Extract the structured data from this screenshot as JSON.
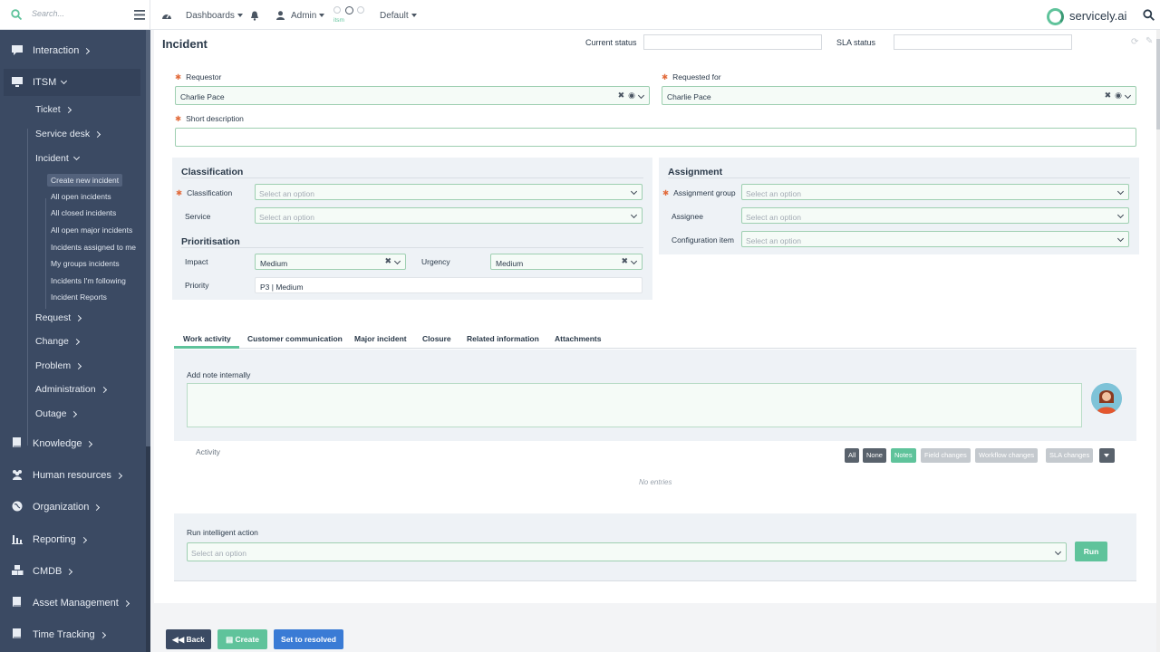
{
  "topbar": {
    "search_placeholder": "Search...",
    "dashboards": "Dashboards",
    "admin": "Admin",
    "itsm_label": "itsm",
    "default": "Default",
    "brand": "servicely.ai"
  },
  "sidebar": {
    "top_items": [
      "Interaction",
      "ITSM",
      "Knowledge",
      "Human resources",
      "Organization",
      "Reporting",
      "CMDB",
      "Asset Management",
      "Time Tracking"
    ],
    "itsm_sub": [
      "Ticket",
      "Service desk",
      "Incident",
      "Request",
      "Change",
      "Problem",
      "Administration",
      "Outage"
    ],
    "incident_sub": [
      "Create new incident",
      "All open incidents",
      "All closed incidents",
      "All open major incidents",
      "Incidents assigned to me",
      "My groups incidents",
      "Incidents I'm following",
      "Incident Reports"
    ]
  },
  "header": {
    "title": "Incident",
    "current_status_label": "Current status",
    "sla_status_label": "SLA status"
  },
  "form": {
    "requestor_label": "Requestor",
    "requestor_value": "Charlie Pace",
    "requested_for_label": "Requested for",
    "requested_for_value": "Charlie Pace",
    "short_description_label": "Short description",
    "placeholder": "Select an option"
  },
  "classification": {
    "title": "Classification",
    "classification_label": "Classification",
    "service_label": "Service"
  },
  "prioritisation": {
    "title": "Prioritisation",
    "impact_label": "Impact",
    "impact_value": "Medium",
    "urgency_label": "Urgency",
    "urgency_value": "Medium",
    "priority_label": "Priority",
    "priority_value": "P3 | Medium"
  },
  "assignment": {
    "title": "Assignment",
    "group_label": "Assignment group",
    "assignee_label": "Assignee",
    "ci_label": "Configuration item"
  },
  "tabs": [
    "Work activity",
    "Customer communication",
    "Major incident",
    "Closure",
    "Related information",
    "Attachments"
  ],
  "work": {
    "note_label": "Add note internally",
    "activity_label": "Activity",
    "filters": [
      "All",
      "None",
      "Notes",
      "Field changes",
      "Workflow changes",
      "SLA changes"
    ],
    "no_entries": "No entries",
    "run_label": "Run intelligent action",
    "run_button": "Run"
  },
  "footer": {
    "back": "Back",
    "create": "Create",
    "resolve": "Set to resolved"
  },
  "colors": {
    "sidebar": "#3b4a63",
    "accent": "#5fc39b",
    "primary": "#3a7bd5",
    "back": "#3b4a63"
  }
}
